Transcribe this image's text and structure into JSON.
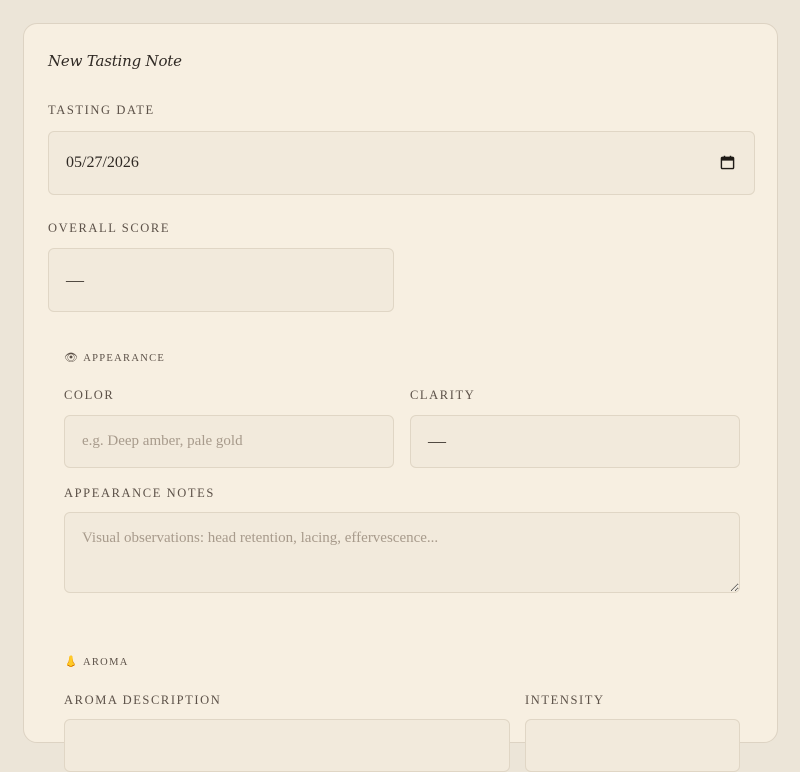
{
  "form": {
    "title": "New Tasting Note",
    "tasting_date": {
      "label": "TASTING DATE",
      "value": "05/27/2026",
      "icon": "calendar-icon"
    },
    "overall_score": {
      "label": "OVERALL SCORE",
      "value": "—"
    }
  },
  "appearance": {
    "icon": "👁",
    "title": "APPEARANCE",
    "color": {
      "label": "COLOR",
      "placeholder": "e.g. Deep amber, pale gold"
    },
    "clarity": {
      "label": "CLARITY",
      "value": "—"
    },
    "notes": {
      "label": "APPEARANCE NOTES",
      "placeholder": "Visual observations: head retention, lacing, effervescence..."
    }
  },
  "aroma": {
    "icon": "👃",
    "title": "AROMA",
    "description": {
      "label": "AROMA DESCRIPTION"
    },
    "intensity": {
      "label": "INTENSITY"
    }
  },
  "colors": {
    "page_bg": "#ece5d8",
    "card_bg": "#f7efe1",
    "field_bg": "#f2eadc"
  }
}
